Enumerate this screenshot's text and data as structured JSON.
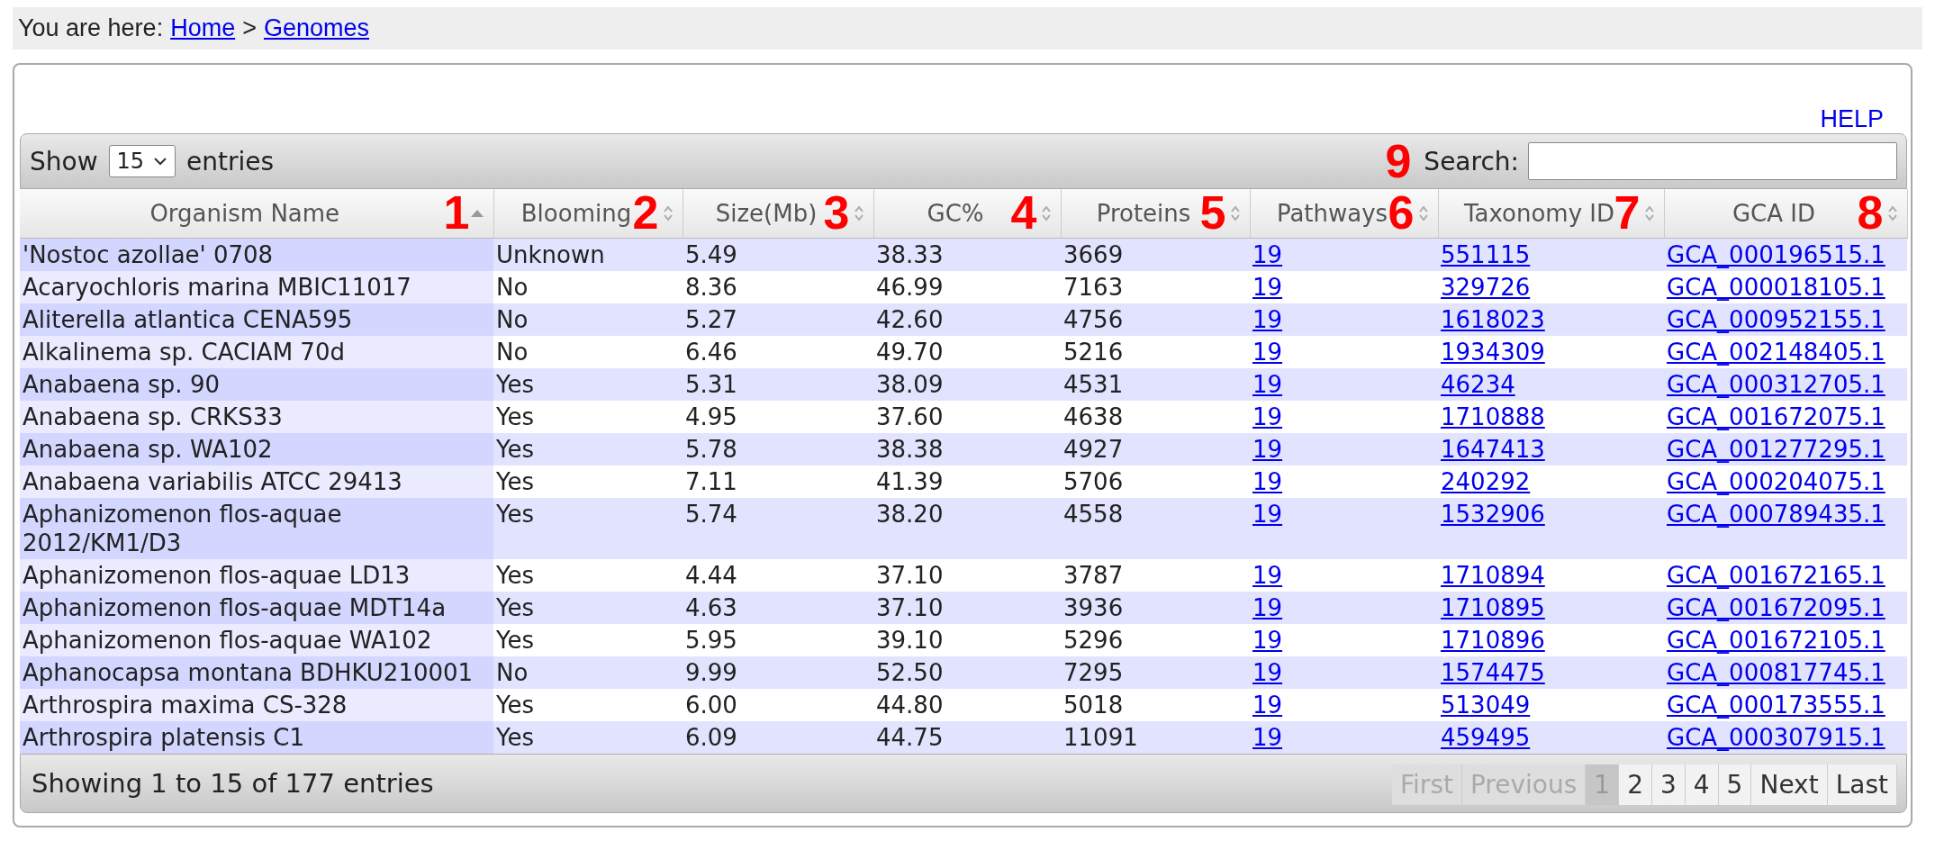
{
  "breadcrumb": {
    "prefix": "You are here:",
    "links": [
      "Home",
      "Genomes"
    ],
    "separator": ">"
  },
  "help": "HELP",
  "length_menu": {
    "before": "Show",
    "value": "15",
    "after": "entries"
  },
  "search": {
    "label": "Search:",
    "marker": "9"
  },
  "table": {
    "columns": [
      {
        "label": "Organism Name",
        "sorted": true,
        "kind": "text",
        "marker": "1"
      },
      {
        "label": "Blooming",
        "sorted": false,
        "kind": "text",
        "marker": "2"
      },
      {
        "label": "Size(Mb)",
        "sorted": false,
        "kind": "text",
        "marker": "3"
      },
      {
        "label": "GC%",
        "sorted": false,
        "kind": "text",
        "marker": "4"
      },
      {
        "label": "Proteins",
        "sorted": false,
        "kind": "text",
        "marker": "5"
      },
      {
        "label": "Pathways",
        "sorted": false,
        "kind": "link",
        "marker": "6"
      },
      {
        "label": "Taxonomy ID",
        "sorted": false,
        "kind": "link",
        "marker": "7"
      },
      {
        "label": "GCA ID",
        "sorted": false,
        "kind": "link",
        "marker": "8"
      }
    ],
    "rows": [
      [
        "'Nostoc azollae' 0708",
        "Unknown",
        "5.49",
        "38.33",
        "3669",
        "19",
        "551115",
        "GCA_000196515.1"
      ],
      [
        "Acaryochloris marina MBIC11017",
        "No",
        "8.36",
        "46.99",
        "7163",
        "19",
        "329726",
        "GCA_000018105.1"
      ],
      [
        "Aliterella atlantica CENA595",
        "No",
        "5.27",
        "42.60",
        "4756",
        "19",
        "1618023",
        "GCA_000952155.1"
      ],
      [
        "Alkalinema sp. CACIAM 70d",
        "No",
        "6.46",
        "49.70",
        "5216",
        "19",
        "1934309",
        "GCA_002148405.1"
      ],
      [
        "Anabaena sp. 90",
        "Yes",
        "5.31",
        "38.09",
        "4531",
        "19",
        "46234",
        "GCA_000312705.1"
      ],
      [
        "Anabaena sp. CRKS33",
        "Yes",
        "4.95",
        "37.60",
        "4638",
        "19",
        "1710888",
        "GCA_001672075.1"
      ],
      [
        "Anabaena sp. WA102",
        "Yes",
        "5.78",
        "38.38",
        "4927",
        "19",
        "1647413",
        "GCA_001277295.1"
      ],
      [
        "Anabaena variabilis ATCC 29413",
        "Yes",
        "7.11",
        "41.39",
        "5706",
        "19",
        "240292",
        "GCA_000204075.1"
      ],
      [
        "Aphanizomenon flos-aquae 2012/KM1/D3",
        "Yes",
        "5.74",
        "38.20",
        "4558",
        "19",
        "1532906",
        "GCA_000789435.1"
      ],
      [
        "Aphanizomenon flos-aquae LD13",
        "Yes",
        "4.44",
        "37.10",
        "3787",
        "19",
        "1710894",
        "GCA_001672165.1"
      ],
      [
        "Aphanizomenon flos-aquae MDT14a",
        "Yes",
        "4.63",
        "37.10",
        "3936",
        "19",
        "1710895",
        "GCA_001672095.1"
      ],
      [
        "Aphanizomenon flos-aquae WA102",
        "Yes",
        "5.95",
        "39.10",
        "5296",
        "19",
        "1710896",
        "GCA_001672105.1"
      ],
      [
        "Aphanocapsa montana BDHKU210001",
        "No",
        "9.99",
        "52.50",
        "7295",
        "19",
        "1574475",
        "GCA_000817745.1"
      ],
      [
        "Arthrospira maxima CS-328",
        "Yes",
        "6.00",
        "44.80",
        "5018",
        "19",
        "513049",
        "GCA_000173555.1"
      ],
      [
        "Arthrospira platensis C1",
        "Yes",
        "6.09",
        "44.75",
        "11091",
        "19",
        "459495",
        "GCA_000307915.1"
      ]
    ]
  },
  "info": "Showing 1 to 15 of 177 entries",
  "pagination": [
    {
      "label": "First",
      "disabled": true,
      "selected": false
    },
    {
      "label": "Previous",
      "disabled": true,
      "selected": false
    },
    {
      "label": "1",
      "disabled": false,
      "selected": true
    },
    {
      "label": "2",
      "disabled": false,
      "selected": false
    },
    {
      "label": "3",
      "disabled": false,
      "selected": false
    },
    {
      "label": "4",
      "disabled": false,
      "selected": false
    },
    {
      "label": "5",
      "disabled": false,
      "selected": false
    },
    {
      "label": "Next",
      "disabled": false,
      "selected": false
    },
    {
      "label": "Last",
      "disabled": false,
      "selected": false
    }
  ]
}
